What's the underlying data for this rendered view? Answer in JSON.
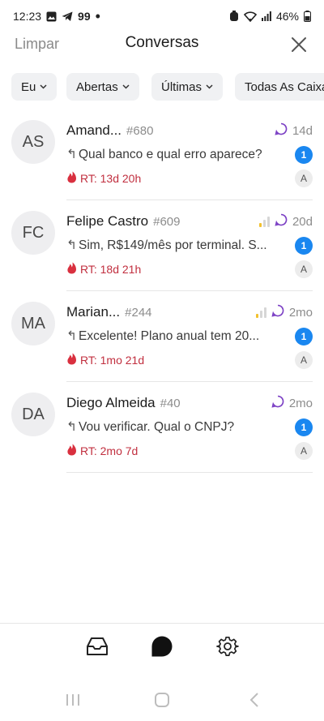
{
  "status_bar": {
    "time": "12:23",
    "notification_count": "99",
    "battery": "46%"
  },
  "header": {
    "clear_label": "Limpar",
    "title": "Conversas"
  },
  "filters": [
    {
      "label": "Eu"
    },
    {
      "label": "Abertas"
    },
    {
      "label": "Últimas"
    },
    {
      "label": "Todas As Caixas"
    }
  ],
  "conversations": [
    {
      "initials": "AS",
      "name": "Amand...",
      "id": "#680",
      "time": "14d",
      "message": "Qual banco e qual erro aparece?",
      "unread": "1",
      "response_time": "RT: 13d 20h",
      "agent": "A",
      "priority_level": 0
    },
    {
      "initials": "FC",
      "name": "Felipe Castro",
      "id": "#609",
      "time": "20d",
      "message": "Sim, R$149/mês por terminal. S...",
      "unread": "1",
      "response_time": "RT: 18d 21h",
      "agent": "A",
      "priority_level": 1
    },
    {
      "initials": "MA",
      "name": "Marian...",
      "id": "#244",
      "time": "2mo",
      "message": "Excelente! Plano anual tem 20...",
      "unread": "1",
      "response_time": "RT: 1mo 21d",
      "agent": "A",
      "priority_level": 1
    },
    {
      "initials": "DA",
      "name": "Diego Almeida",
      "id": "#40",
      "time": "2mo",
      "message": "Vou verificar. Qual o CNPJ?",
      "unread": "1",
      "response_time": "RT: 2mo 7d",
      "agent": "A",
      "priority_level": 0
    }
  ],
  "colors": {
    "accent_blue": "#1a87f0",
    "rt_red": "#c12f3f",
    "priority_yellow": "#f2c12e",
    "chat_purple": "#7b3fc4"
  }
}
